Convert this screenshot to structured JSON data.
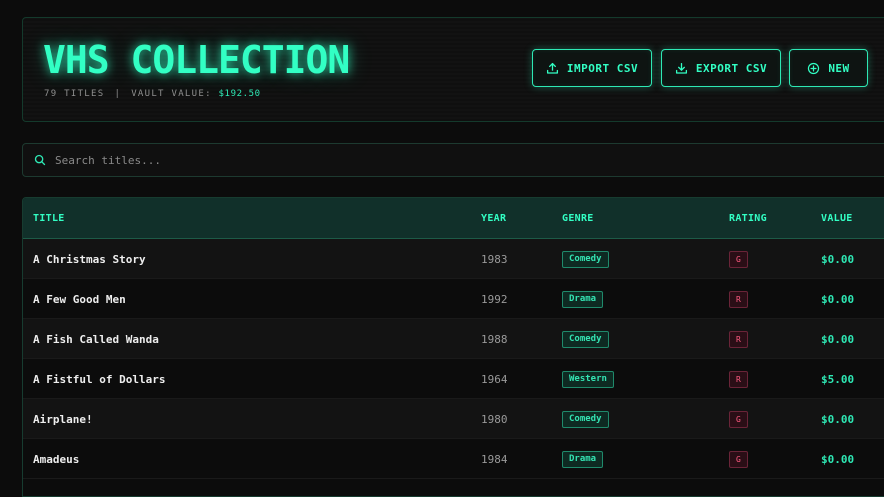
{
  "header": {
    "title": "VHS COLLECTION",
    "title_count": "79 TITLES",
    "separator": "|",
    "vault_label": "VAULT VALUE:",
    "vault_value": "$192.50"
  },
  "toolbar": {
    "import_label": "IMPORT CSV",
    "export_label": "EXPORT CSV",
    "new_label": "NEW"
  },
  "search": {
    "placeholder": "Search titles...",
    "value": ""
  },
  "table": {
    "columns": [
      "TITLE",
      "YEAR",
      "GENRE",
      "RATING",
      "VALUE"
    ],
    "rows": [
      {
        "title": "A Christmas Story",
        "year": "1983",
        "genre": "Comedy",
        "rating": "G",
        "value": "$0.00"
      },
      {
        "title": "A Few Good Men",
        "year": "1992",
        "genre": "Drama",
        "rating": "R",
        "value": "$0.00"
      },
      {
        "title": "A Fish Called Wanda",
        "year": "1988",
        "genre": "Comedy",
        "rating": "R",
        "value": "$0.00"
      },
      {
        "title": "A Fistful of Dollars",
        "year": "1964",
        "genre": "Western",
        "rating": "R",
        "value": "$5.00"
      },
      {
        "title": "Airplane!",
        "year": "1980",
        "genre": "Comedy",
        "rating": "G",
        "value": "$0.00"
      },
      {
        "title": "Amadeus",
        "year": "1984",
        "genre": "Drama",
        "rating": "G",
        "value": "$0.00"
      }
    ]
  },
  "colors": {
    "accent": "#32ffc4",
    "rating": "#ff5a80",
    "background": "#0c0c0c"
  },
  "icons": {
    "import": "upload-icon",
    "export": "download-icon",
    "new": "plus-circle-icon",
    "search": "search-icon"
  }
}
